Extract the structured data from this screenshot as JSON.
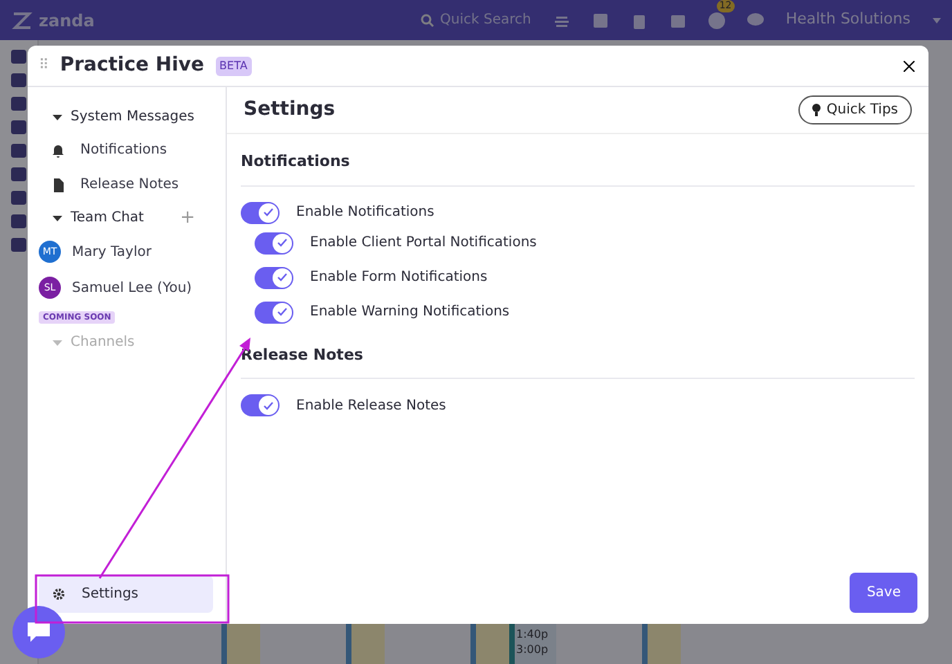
{
  "topbar": {
    "logo": "zanda",
    "search": {
      "placeholder": "Quick Search"
    },
    "tasks_badge": "12",
    "account": "Health Solutions"
  },
  "calendar_strip": {
    "times": [
      "1:40p",
      "3:00p"
    ]
  },
  "modal": {
    "drag_handle": "⠿",
    "title": "Practice Hive",
    "badge": "BETA",
    "sidebar": {
      "groups": [
        {
          "label": "System Messages",
          "expanded": true,
          "kind": "header",
          "items": [
            {
              "label": "Notifications",
              "kind": "bell",
              "selected": false
            },
            {
              "label": "Release Notes",
              "kind": "document",
              "selected": false
            }
          ]
        },
        {
          "label": "Team Chat",
          "expanded": true,
          "kind": "header",
          "add": "+",
          "items": [
            {
              "label": "Mary Taylor",
              "initials": "MT",
              "color": "#1f6fd0",
              "selected": false
            },
            {
              "label": "Samuel Lee (You)",
              "initials": "SL",
              "color": "#7b1fa2",
              "selected": false
            }
          ]
        },
        {
          "label": "Channels",
          "expanded": true,
          "kind": "disabled",
          "tag": "COMING SOON"
        }
      ],
      "settings_item": {
        "label": "Settings",
        "selected": true
      }
    },
    "content": {
      "title": "Settings",
      "tips_button": "Quick Tips",
      "sections": [
        {
          "heading": "Notifications",
          "toggles": [
            {
              "label": "Enable Notifications",
              "checked": true,
              "children": [
                {
                  "label": "Enable Client Portal Notifications",
                  "checked": true
                },
                {
                  "label": "Enable Form Notifications",
                  "checked": true
                },
                {
                  "label": "Enable Warning Notifications",
                  "checked": true
                }
              ]
            }
          ]
        },
        {
          "heading": "Release Notes",
          "toggles": [
            {
              "label": "Enable Release Notes",
              "checked": true
            }
          ]
        }
      ],
      "save_button": "Save"
    }
  }
}
